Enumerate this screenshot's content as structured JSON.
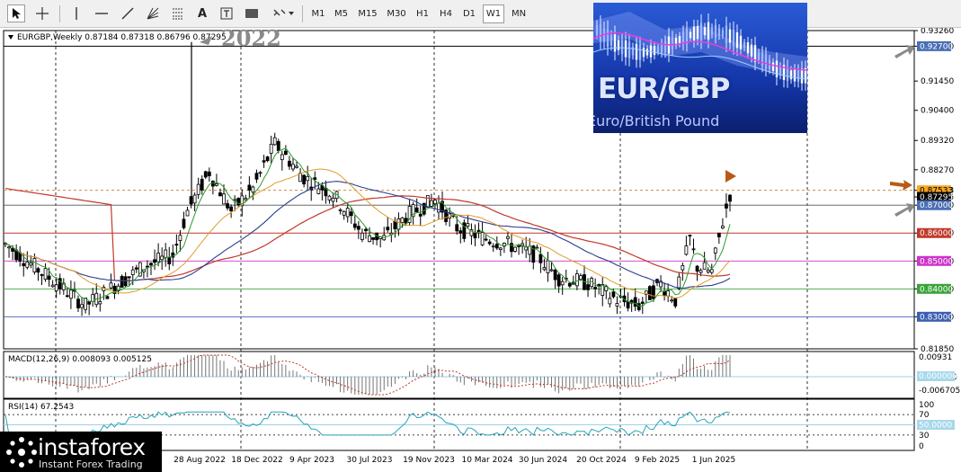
{
  "toolbar": {
    "tools": [
      "cursor-icon",
      "crosshair-icon",
      "vertical-line-icon",
      "horizontal-line-icon",
      "trendline-icon",
      "gann-fan-icon",
      "fibonacci-icon",
      "text-icon",
      "label-icon",
      "rectangle-icon",
      "shapes-menu-icon"
    ],
    "text_tool": "A",
    "timeframes": [
      "M1",
      "M5",
      "M15",
      "M30",
      "H1",
      "H4",
      "D1",
      "W1",
      "MN"
    ],
    "active_timeframe": "W1"
  },
  "chart": {
    "symbol_info": "EURGBP,Weekly  0.87184 0.87318 0.86796 0.87295",
    "overlay_year": "2022",
    "price_axis": [
      "0.93260",
      "0.92700",
      "0.91450",
      "0.90400",
      "0.89320",
      "0.88270",
      "0.87533",
      "0.87295",
      "0.87000",
      "0.86000",
      "0.85000",
      "0.84000",
      "0.83000",
      "0.81850"
    ],
    "price_badges": [
      {
        "value": "0.92700",
        "bg": "#4a6fb5",
        "fg": "#ffffff"
      },
      {
        "value": "0.87533",
        "bg": "#f6a623",
        "fg": "#000000"
      },
      {
        "value": "0.87295",
        "bg": "#000000",
        "fg": "#ffffff"
      },
      {
        "value": "0.87000",
        "bg": "#4a6fb5",
        "fg": "#ffffff"
      },
      {
        "value": "0.86000",
        "bg": "#c0392b",
        "fg": "#ffffff"
      },
      {
        "value": "0.85000",
        "bg": "#cc33cc",
        "fg": "#ffffff"
      },
      {
        "value": "0.84000",
        "bg": "#3aa33a",
        "fg": "#ffffff"
      },
      {
        "value": "0.83000",
        "bg": "#3c5fb0",
        "fg": "#ffffff"
      }
    ],
    "time_axis": [
      "28 Aug 2022",
      "18 Dec 2022",
      "9 Apr 2023",
      "30 Jul 2023",
      "19 Nov 2023",
      "10 Mar 2024",
      "30 Jun 2024",
      "20 Oct 2024",
      "9 Feb 2025",
      "1 Jun 2025"
    ],
    "colors": {
      "ma_red": "#c0392b",
      "ma_navy": "#2c3e8f",
      "ma_orange": "#e39b2a",
      "ma_green": "#2e9a2e",
      "macd": "#c0392b",
      "rsi": "#23a5b5"
    }
  },
  "macd": {
    "label": "MACD(12,26,9) 0.008093 0.005125",
    "axis": [
      "0.00931",
      "0.000000",
      "-0.006705"
    ]
  },
  "rsi": {
    "label": "RSI(14) 67.2543",
    "axis": [
      "100",
      "70",
      "50.0000",
      "30",
      "0"
    ]
  },
  "inset": {
    "title": "EUR/GBP",
    "subtitle": "Euro/British Pound"
  },
  "logo": {
    "name": "instaforex",
    "tagline": "Instant Forex Trading"
  }
}
